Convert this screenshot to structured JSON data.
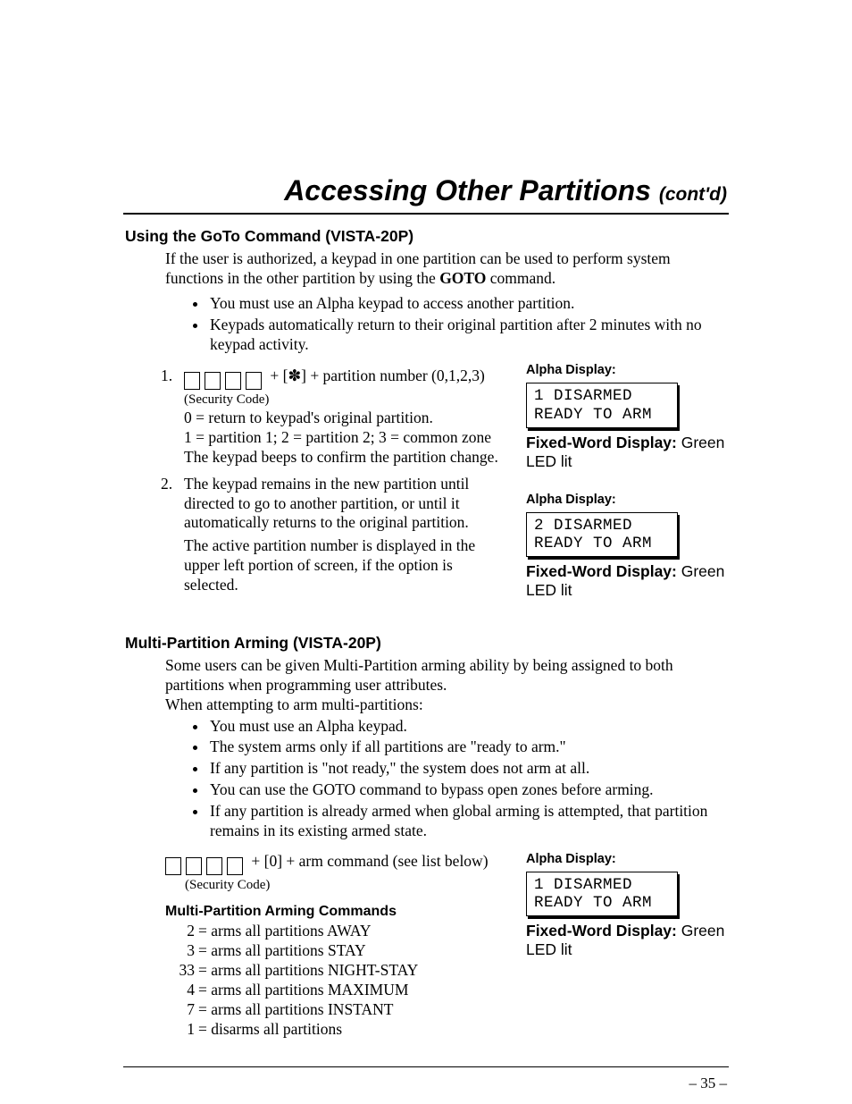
{
  "title_main": "Accessing Other Partitions ",
  "title_contd": "(cont'd)",
  "section1_hdr": "Using the GoTo Command (VISTA-20P)",
  "section1_intro_a": "If the user is authorized, a keypad in one partition can be used to perform system functions in the other partition by using the ",
  "section1_intro_bold": "GOTO",
  "section1_intro_b": " command.",
  "section1_bullets": [
    "You must use an Alpha keypad to access another partition.",
    "Keypads automatically return to their original partition after 2 minutes with no keypad activity."
  ],
  "step1": {
    "num": "1.",
    "line1": " +  [✽] + partition number (0,1,2,3)",
    "sec_code": "(Security Code)",
    "line2": "0 = return to keypad's original partition.",
    "line3": "1 = partition 1; 2 = partition 2; 3 = common zone",
    "line4": "The keypad beeps to confirm the partition change."
  },
  "step2": {
    "num": "2.",
    "para1": "The keypad remains in the new partition until directed to go to another partition, or until it automatically returns to the original partition.",
    "para2": "The active partition number is displayed in the upper left portion of screen, if the option is selected."
  },
  "alpha_label": "Alpha Display:",
  "lcd1_line1": "1 DISARMED",
  "lcd1_line2": "READY TO ARM",
  "lcd2_line1": "2 DISARMED",
  "lcd2_line2": "READY TO ARM",
  "fw_label": "Fixed-Word Display: ",
  "fw_value": "Green LED lit",
  "section2_hdr": "Multi-Partition Arming (VISTA-20P)",
  "section2_intro": "Some users can be given Multi-Partition arming ability by being assigned to both partitions when programming user attributes.",
  "section2_intro2": "When attempting to arm multi-partitions:",
  "section2_bullets": [
    "You must use an Alpha keypad.",
    "The system arms only if all partitions are \"ready to arm.\"",
    "If any partition is \"not ready,\" the system does not arm at all.",
    "You can use the GOTO command to bypass open zones before arming.",
    "If any partition is already armed when global arming is attempted, that partition remains in its existing armed state."
  ],
  "step3": {
    "line1": " +  [0] + arm command (see list below)",
    "sec_code": "(Security Code)"
  },
  "cmd_hdr": "Multi-Partition Arming Commands",
  "cmds": [
    {
      "k": "2",
      "v": "= arms all partitions AWAY"
    },
    {
      "k": "3",
      "v": "= arms all partitions STAY"
    },
    {
      "k": "33",
      "v": "= arms all partitions NIGHT-STAY"
    },
    {
      "k": "4",
      "v": "= arms all partitions MAXIMUM"
    },
    {
      "k": "7",
      "v": "= arms all partitions INSTANT"
    },
    {
      "k": "1",
      "v": "= disarms all partitions"
    }
  ],
  "page_num": "– 35 –"
}
